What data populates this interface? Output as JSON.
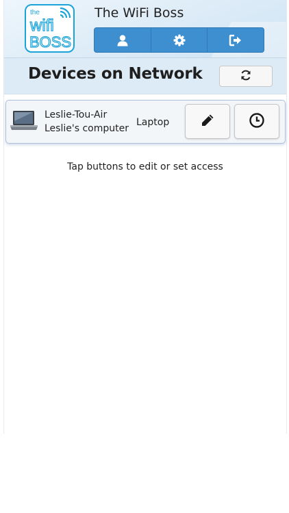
{
  "header": {
    "title": "The WiFi Boss",
    "logo": {
      "line1": "the",
      "line2": "wifi",
      "line3": "BOSS",
      "color": "#1aa3d9"
    },
    "tabs": [
      {
        "icon": "user-icon"
      },
      {
        "icon": "gear-icon"
      },
      {
        "icon": "sign-out-icon"
      }
    ],
    "tab_color": "#3d8fd0"
  },
  "section": {
    "title": "Devices on Network",
    "refresh_icon": "refresh-icon"
  },
  "devices": [
    {
      "icon": "laptop-icon",
      "name": "Leslie-Tou-Air",
      "owner": "Leslie's computer",
      "type": "Laptop",
      "actions": [
        "pencil-icon",
        "clock-icon"
      ]
    }
  ],
  "hint": "Tap buttons to edit or set access"
}
